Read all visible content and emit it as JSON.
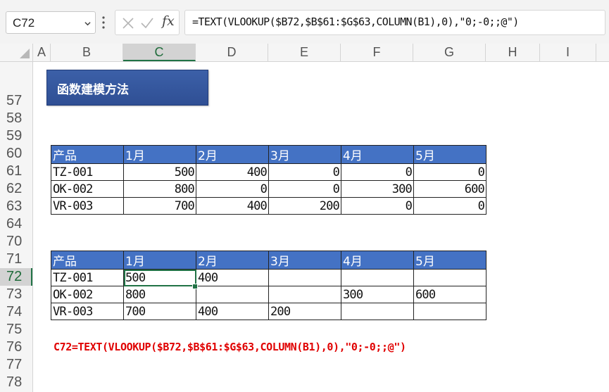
{
  "formula_bar": {
    "name_box": "C72",
    "formula": "=TEXT(VLOOKUP($B72,$B$61:$G$63,COLUMN(B1),0),\"0;-0;;@\")"
  },
  "columns": [
    "A",
    "B",
    "C",
    "D",
    "E",
    "F",
    "G",
    "H",
    "I"
  ],
  "rows": [
    "57",
    "58",
    "59",
    "60",
    "61",
    "62",
    "63",
    "64",
    "70",
    "71",
    "72",
    "73",
    "74",
    "75",
    "76",
    "77",
    "78"
  ],
  "title": "函数建模方法",
  "table1": {
    "headers": [
      "产品",
      "1月",
      "2月",
      "3月",
      "4月",
      "5月"
    ],
    "rows": [
      [
        "TZ-001",
        "500",
        "400",
        "0",
        "0",
        "0"
      ],
      [
        "OK-002",
        "800",
        "0",
        "0",
        "300",
        "600"
      ],
      [
        "VR-003",
        "700",
        "400",
        "200",
        "0",
        "0"
      ]
    ]
  },
  "table2": {
    "headers": [
      "产品",
      "1月",
      "2月",
      "3月",
      "4月",
      "5月"
    ],
    "rows": [
      [
        "TZ-001",
        "500",
        "400",
        "",
        "",
        ""
      ],
      [
        "OK-002",
        "800",
        "",
        "",
        "300",
        "600"
      ],
      [
        "VR-003",
        "700",
        "400",
        "200",
        "",
        ""
      ]
    ]
  },
  "note": "C72=TEXT(VLOOKUP($B72,$B$61:$G$63,COLUMN(B1),0),\"0;-0;;@\")",
  "icons": {
    "cancel": "x-icon",
    "confirm": "check-icon",
    "function": "fx-icon",
    "dropdown": "chevron-down-icon",
    "select_all": "select-all-triangle"
  },
  "colors": {
    "header_fill": "#4472c4",
    "title_fill": "#2f4f94",
    "selection": "#217346",
    "note_text": "#e00000"
  }
}
